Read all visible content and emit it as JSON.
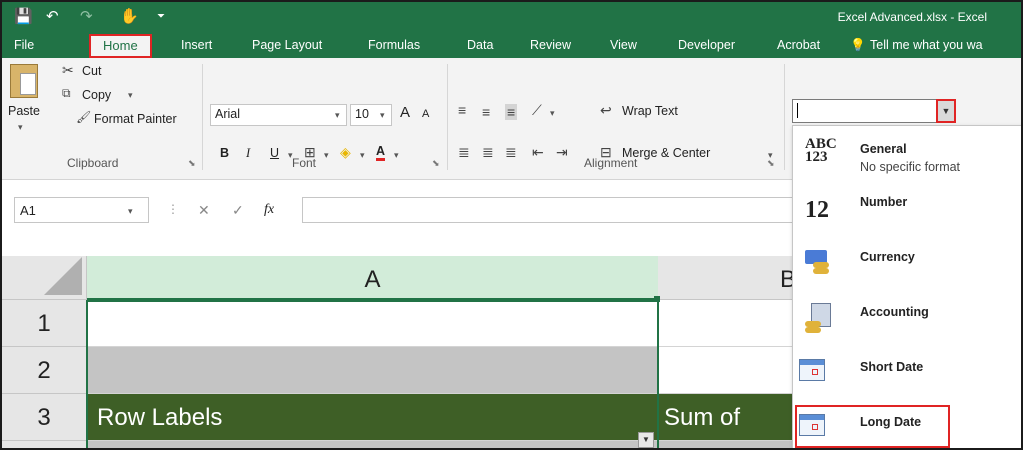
{
  "titlebar": {
    "save_icon": "💾",
    "undo_icon": "↶",
    "redo_icon": "↷",
    "touch_icon": "✋",
    "customize_icon": "⏷",
    "title": "Excel Advanced.xlsx - Excel"
  },
  "tabs": [
    {
      "label": "File"
    },
    {
      "label": "Home"
    },
    {
      "label": "Insert"
    },
    {
      "label": "Page Layout"
    },
    {
      "label": "Formulas"
    },
    {
      "label": "Data"
    },
    {
      "label": "Review"
    },
    {
      "label": "View"
    },
    {
      "label": "Developer"
    },
    {
      "label": "Acrobat"
    }
  ],
  "tell_me": "Tell me what you wa",
  "clipboard": {
    "paste": "Paste",
    "cut": "Cut",
    "copy": "Copy",
    "format_painter": "Format Painter",
    "group_label": "Clipboard"
  },
  "font": {
    "name": "Arial",
    "size": "10",
    "bold": "B",
    "italic": "I",
    "underline": "U",
    "grow": "A",
    "shrink": "A",
    "color": "A",
    "group_label": "Font"
  },
  "alignment": {
    "wrap_text": "Wrap Text",
    "merge_center": "Merge & Center",
    "group_label": "Alignment"
  },
  "formula_bar": {
    "name_box": "A1",
    "cancel": "✕",
    "enter": "✓",
    "fx": "fx"
  },
  "grid": {
    "columns": [
      "A",
      "B"
    ],
    "rows": [
      "1",
      "2",
      "3"
    ],
    "row3_a": "Row Labels",
    "row3_b": "Sum of"
  },
  "number_format_menu": {
    "items": [
      {
        "label": "General",
        "sub": "No specific format",
        "icon_text_top": "ABC",
        "icon_text_bottom": "123"
      },
      {
        "label": "Number",
        "icon_text": "12"
      },
      {
        "label": "Currency"
      },
      {
        "label": "Accounting"
      },
      {
        "label": "Short Date"
      },
      {
        "label": "Long Date"
      }
    ],
    "selected": "Long Date"
  }
}
